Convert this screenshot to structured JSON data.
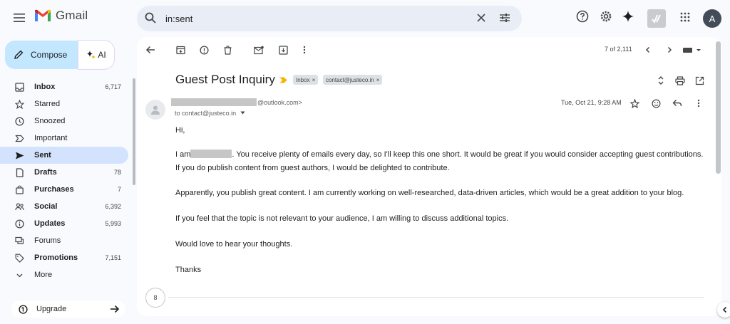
{
  "app": {
    "name": "Gmail"
  },
  "search": {
    "query": "in:sent"
  },
  "account": {
    "initial": "A"
  },
  "compose": {
    "label": "Compose",
    "ai_label": "AI"
  },
  "nav": [
    {
      "label": "Inbox",
      "count": "6,717",
      "icon": "inbox-icon",
      "bold": true
    },
    {
      "label": "Starred",
      "count": "",
      "icon": "star-icon",
      "bold": false
    },
    {
      "label": "Snoozed",
      "count": "",
      "icon": "clock-icon",
      "bold": false
    },
    {
      "label": "Important",
      "count": "",
      "icon": "important-icon",
      "bold": false
    },
    {
      "label": "Sent",
      "count": "",
      "icon": "send-icon",
      "bold": true,
      "active": true
    },
    {
      "label": "Drafts",
      "count": "78",
      "icon": "draft-icon",
      "bold": true
    },
    {
      "label": "Purchases",
      "count": "7",
      "icon": "bag-icon",
      "bold": true
    },
    {
      "label": "Social",
      "count": "6,392",
      "icon": "people-icon",
      "bold": true
    },
    {
      "label": "Updates",
      "count": "5,993",
      "icon": "info-icon",
      "bold": true
    },
    {
      "label": "Forums",
      "count": "",
      "icon": "forum-icon",
      "bold": false
    },
    {
      "label": "Promotions",
      "count": "7,151",
      "icon": "tag-icon",
      "bold": true
    },
    {
      "label": "More",
      "count": "",
      "icon": "chevron-down-icon",
      "bold": false
    }
  ],
  "upgrade": {
    "label": "Upgrade"
  },
  "toolbar": {
    "pager": "7 of 2,111"
  },
  "message": {
    "subject": "Guest Post Inquiry",
    "labels": [
      {
        "text": "Inbox",
        "close": "×"
      },
      {
        "text": "contact@justeco.in",
        "close": "×"
      }
    ],
    "from_domain": "@outlook.com>",
    "to": "to contact@justeco.in",
    "date": "Tue, Oct 21, 9:28 AM",
    "greeting": "Hi,",
    "p1_start": "I am",
    "p1_rest": ". You receive plenty of emails every day, so I'll keep this one short. It would be great if you would consider accepting guest contributions.",
    "p1_line2": "If you do publish content from guest authors, I would be delighted to contribute.",
    "p2": "Apparently, you publish great content. I am currently working on well-researched, data-driven articles, which would be a great addition to your blog.",
    "p3": "If you feel that the topic is not relevant to your audience, I am willing to discuss additional topics.",
    "p4": "Would love to hear your thoughts.",
    "closing": "Thanks",
    "thread_count": "8"
  },
  "colors": {
    "compose_bg": "#c2e7ff",
    "active_nav": "#d3e3fd",
    "important_marker": "#f4b400"
  }
}
